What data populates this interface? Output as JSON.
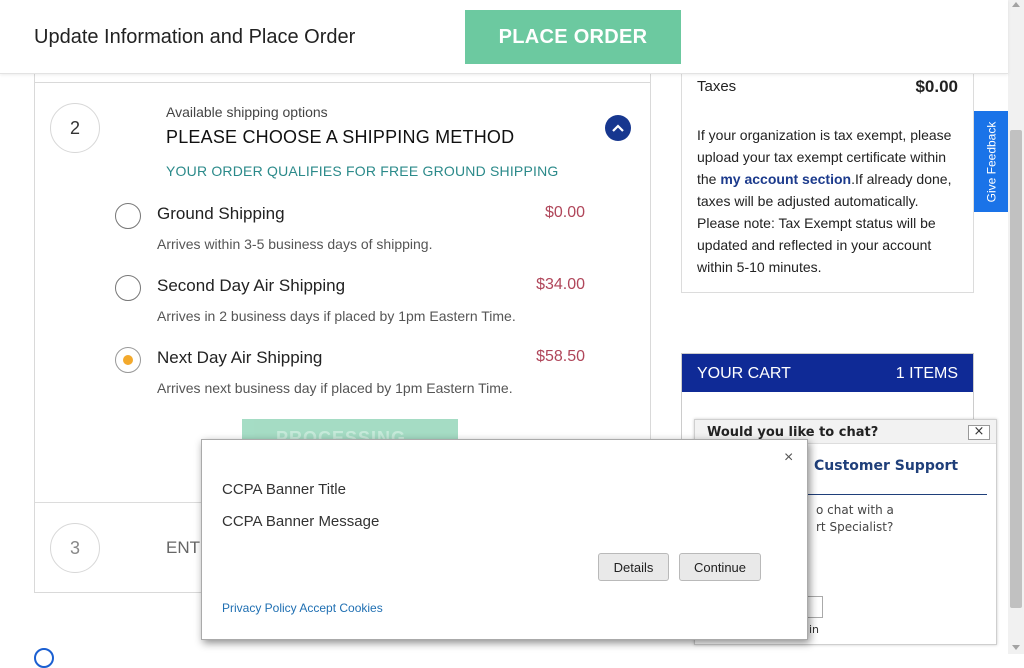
{
  "header": {
    "title": "Update Information and Place Order",
    "place_order_label": "PLACE ORDER"
  },
  "shipping": {
    "step_number": "2",
    "available_label": "Available shipping options",
    "heading": "PLEASE CHOOSE A SHIPPING METHOD",
    "free_notice": "YOUR ORDER QUALIFIES FOR FREE GROUND SHIPPING",
    "options": [
      {
        "name": "Ground Shipping",
        "price": "$0.00",
        "desc": "Arrives within 3-5 business days of shipping.",
        "selected": false
      },
      {
        "name": "Second Day Air Shipping",
        "price": "$34.00",
        "desc": "Arrives in 2 business days if placed by 1pm Eastern Time.",
        "selected": false
      },
      {
        "name": "Next Day Air Shipping",
        "price": "$58.50",
        "desc": "Arrives next business day if placed by 1pm Eastern Time.",
        "selected": true
      }
    ],
    "processing_label": "PROCESSING..."
  },
  "step3": {
    "number": "3",
    "label": "ENT"
  },
  "taxes": {
    "label": "Taxes",
    "value": "$0.00",
    "note_before": "If your organization is tax exempt, please upload your tax exempt certificate within the ",
    "note_link": "my account section",
    "note_after": ".If already done, taxes will be adjusted automatically. Please note: Tax Exempt status will be updated and reflected in your account within 5-10 minutes."
  },
  "cart": {
    "title": "YOUR CART",
    "count": "1 ITEMS"
  },
  "feedback": {
    "label": "Give Feedback"
  },
  "chat": {
    "question": "Would you like to chat?",
    "close": "×",
    "title": "Customer Support",
    "text": "o chat with a\nrt Specialist?",
    "link": "in"
  },
  "ccpa": {
    "close": "×",
    "title": "CCPA Banner Title",
    "message": "CCPA Banner Message",
    "details_label": "Details",
    "continue_label": "Continue",
    "policy_link": "Privacy Policy Accept Cookies"
  },
  "colors": {
    "accent_green": "#6cc9a0",
    "navy": "#0f2a96",
    "price_red": "#b0465a",
    "radio_selected": "#f3a92c",
    "feedback_blue": "#1a73e8"
  }
}
